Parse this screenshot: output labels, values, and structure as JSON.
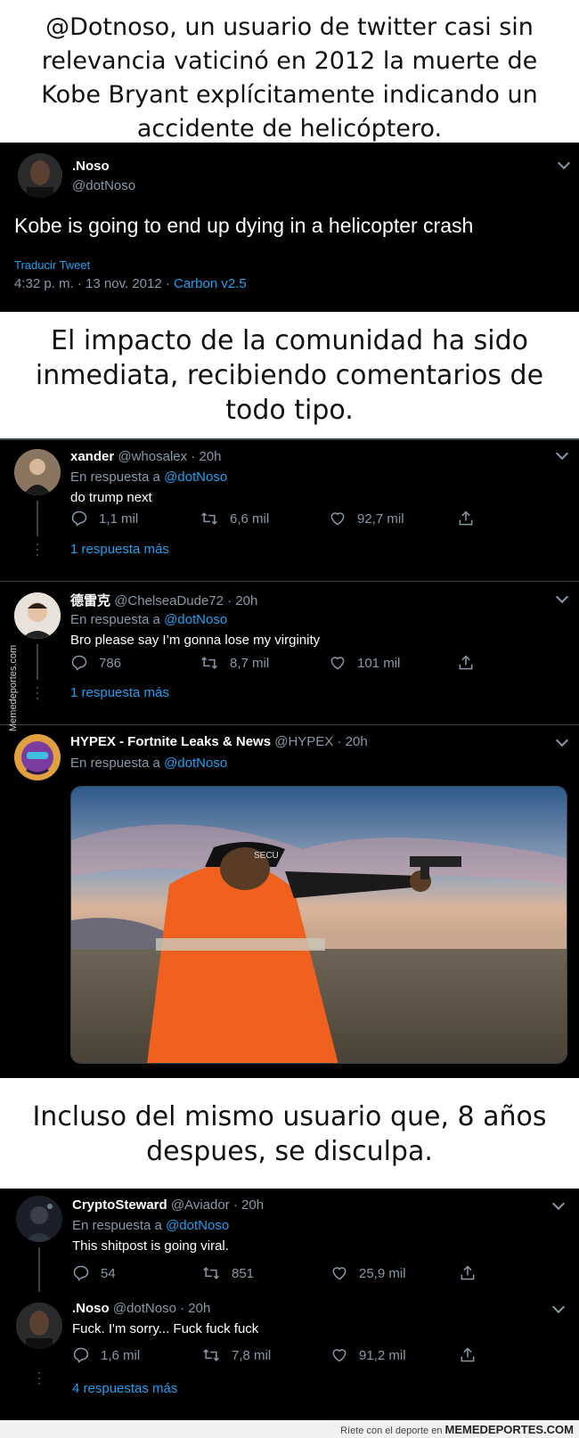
{
  "captions": {
    "top": "@Dotnoso, un usuario de twitter casi sin relevancia vaticinó en 2012 la muerte de Kobe Bryant explícitamente indicando un accidente de helicóptero.",
    "middle": "El impacto de la comunidad ha sido inmediata, recibiendo comentarios de todo tipo.",
    "bottom": "Incluso del mismo usuario que, 8 años despues, se disculpa."
  },
  "original_tweet": {
    "name": ".Noso",
    "handle": "@dotNoso",
    "text": "Kobe is going to end up dying in a helicopter crash",
    "translate": "Traducir Tweet",
    "timestamp": "4:32 p. m. · 13 nov. 2012 · ",
    "client": "Carbon v2.5"
  },
  "replies_1": [
    {
      "name": "xander",
      "handle": "@whosalex · 20h",
      "reply_to_prefix": "En respuesta a ",
      "reply_to": "@dotNoso",
      "text": "do trump next",
      "comments": "1,1 mil",
      "retweets": "6,6 mil",
      "likes": "92,7 mil",
      "more": "1 respuesta más"
    },
    {
      "name": "德雷克",
      "handle": "@ChelseaDude72 · 20h",
      "reply_to_prefix": "En respuesta a ",
      "reply_to": "@dotNoso",
      "text": "Bro please say I’m gonna lose my virginity",
      "comments": "786",
      "retweets": "8,7 mil",
      "likes": "101 mil",
      "more": "1 respuesta más"
    }
  ],
  "hypex_reply": {
    "name": "HYPEX - Fortnite Leaks & News",
    "handle": "@HYPEX · 20h",
    "reply_to_prefix": "En respuesta a ",
    "reply_to": "@dotNoso",
    "cap_text": "SECU"
  },
  "replies_2": [
    {
      "name": "CryptoSteward",
      "handle": "@Aviador · 20h",
      "reply_to_prefix": "En respuesta a ",
      "reply_to": "@dotNoso",
      "text": "This shitpost is going viral.",
      "comments": "54",
      "retweets": "851",
      "likes": "25,9 mil"
    },
    {
      "name": ".Noso",
      "handle": "@dotNoso · 20h",
      "text": "Fuck. I'm sorry... Fuck fuck fuck",
      "comments": "1,6 mil",
      "retweets": "7,8 mil",
      "likes": "91,2 mil",
      "more": "4 respuestas más"
    }
  ],
  "watermark": "Memedeportes.com",
  "footer": {
    "text": "Ríete con el deporte en ",
    "brand": "MEMEDEPORTES.COM"
  },
  "colors": {
    "background": "#000000",
    "link": "#1da1f2",
    "muted": "#8899a6"
  }
}
